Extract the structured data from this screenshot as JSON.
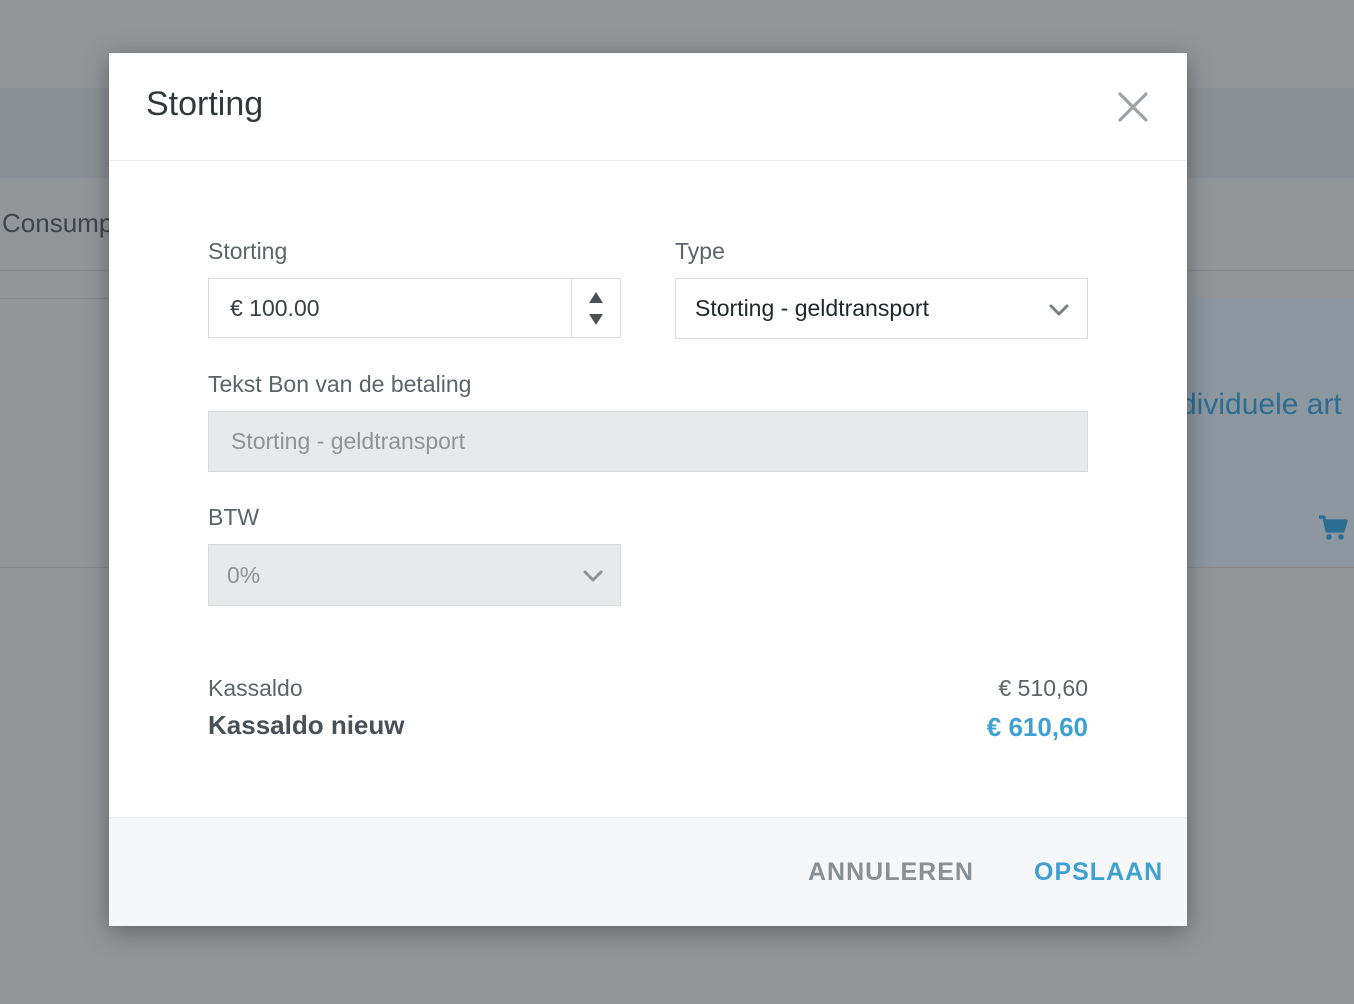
{
  "background": {
    "tab_label": "Consump",
    "card_text": "dividuele art"
  },
  "modal": {
    "title": "Storting",
    "close_icon": "close-icon",
    "fields": {
      "storting_label": "Storting",
      "storting_value": "€ 100.00",
      "type_label": "Type",
      "type_value": "Storting - geldtransport",
      "receipt_label": "Tekst Bon van de betaling",
      "receipt_value": "Storting - geldtransport",
      "btw_label": "BTW",
      "btw_value": "0%"
    },
    "balance": {
      "label": "Kassaldo",
      "value": "€ 510,60",
      "new_label": "Kassaldo nieuw",
      "new_value": "€ 610,60"
    },
    "footer": {
      "cancel_label": "ANNULEREN",
      "save_label": "OPSLAAN"
    }
  },
  "colors": {
    "accent": "#3fa0d2",
    "overlay": "#939699",
    "disabled_bg": "#e8e9ea"
  }
}
